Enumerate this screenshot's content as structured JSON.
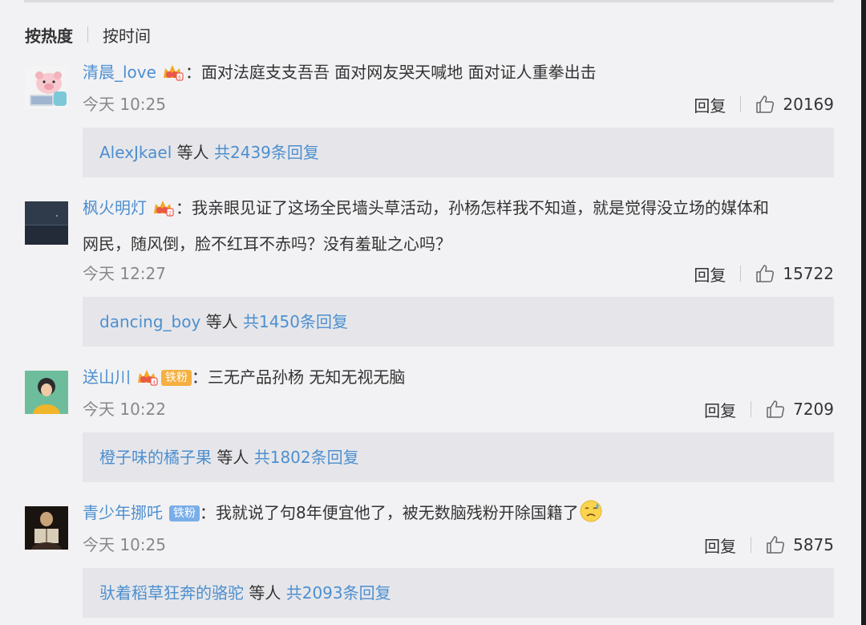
{
  "sort": {
    "hot_label": "按热度",
    "time_label": "按时间"
  },
  "comments": [
    {
      "username": "清晨_love",
      "text": "面对法庭支支吾吾 面对网友哭天喊地 面对证人重拳出击",
      "time": "今天 10:25",
      "reply_label": "回复",
      "likes": "20169",
      "reply_summary": {
        "user": "AlexJkael",
        "middle": "等人",
        "count_text": "共2439条回复"
      }
    },
    {
      "username": "枫火明灯",
      "text_line1": "我亲眼见证了这场全民墙头草活动，孙杨怎样我不知道，就是觉得没立场的媒体和",
      "text_line2": "网民，随风倒，脸不红耳不赤吗？没有羞耻之心吗？",
      "time": "今天 12:27",
      "reply_label": "回复",
      "likes": "15722",
      "reply_summary": {
        "user": "dancing_boy",
        "middle": "等人",
        "count_text": "共1450条回复"
      }
    },
    {
      "username": "送山川",
      "fan_tag": "铁粉",
      "text": "三无产品孙杨 无知无视无脑",
      "time": "今天 10:22",
      "reply_label": "回复",
      "likes": "7209",
      "reply_summary": {
        "user": "橙子味的橘子果",
        "middle": "等人",
        "count_text": "共1802条回复"
      }
    },
    {
      "username": "青少年挪吒",
      "fan_tag": "铁粉",
      "text": "我就说了句8年便宜他了，被无数脑残粉开除国籍了",
      "time": "今天 10:25",
      "reply_label": "回复",
      "likes": "5875",
      "reply_summary": {
        "user": "驮着稻草狂奔的骆驼",
        "middle": "等人",
        "count_text": "共2093条回复"
      }
    }
  ],
  "colors": {
    "link": "#4d8fcf",
    "background": "#f2f2f4",
    "reply_box": "#e6e6ea",
    "fan_gold": "#f5b041",
    "fan_blue": "#7aaee8"
  },
  "icons": [
    "crown-badge-icon",
    "thumbs-up-icon",
    "sad-sweat-emoji-icon"
  ]
}
